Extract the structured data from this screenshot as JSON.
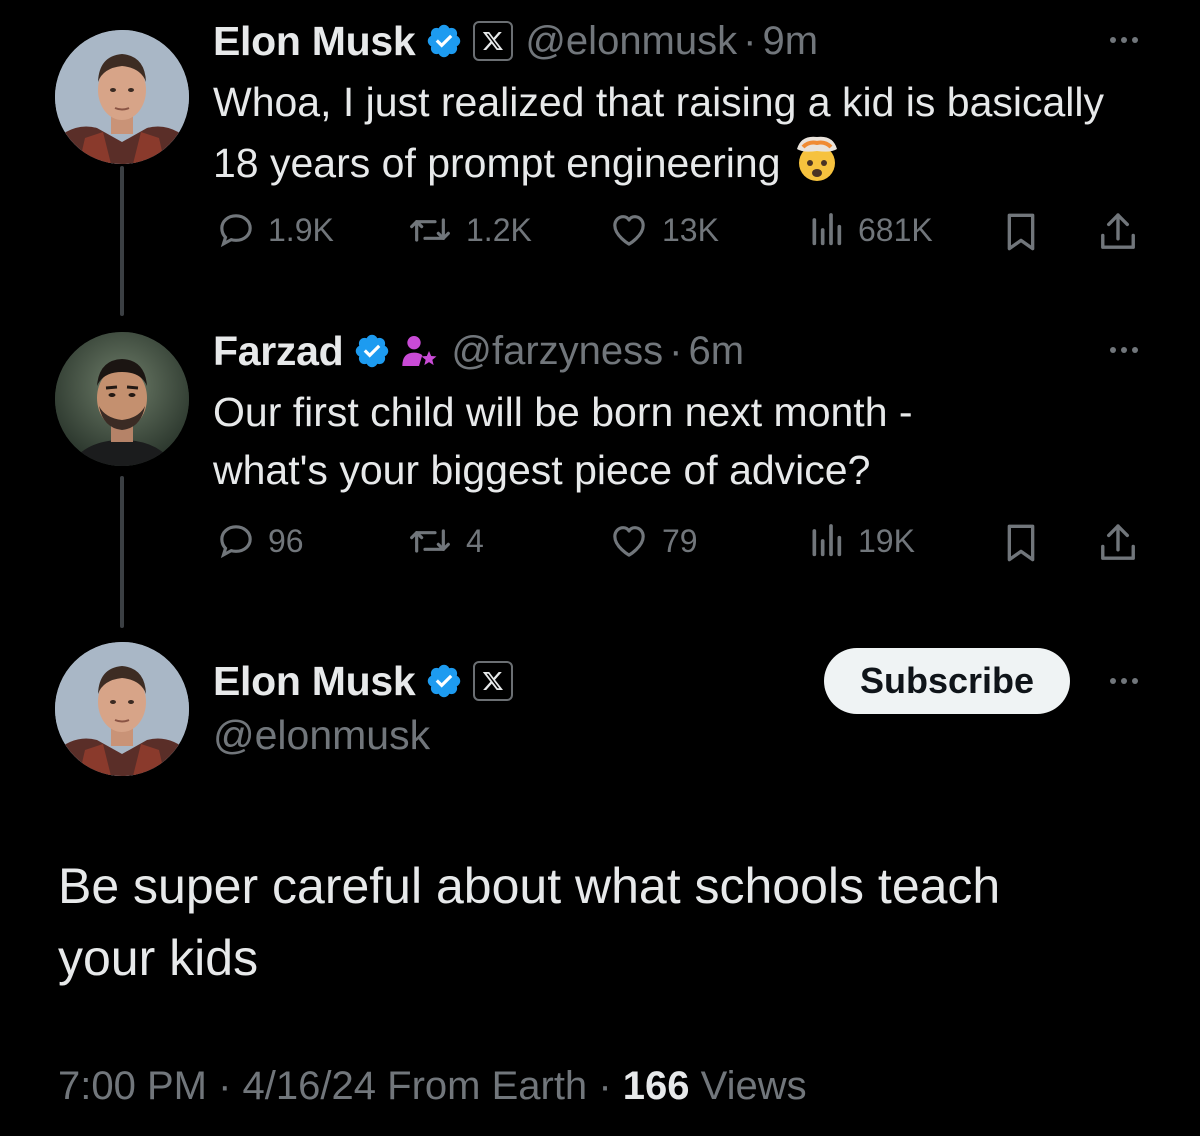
{
  "tweets": [
    {
      "name": "Elon Musk",
      "handle": "@elonmusk",
      "separator": "·",
      "time": "9m",
      "text": "Whoa, I just realized that raising a kid is basically 18 years of prompt engineering",
      "stats": {
        "replies": "1.9K",
        "reposts": "1.2K",
        "likes": "13K",
        "views": "681K"
      }
    },
    {
      "name": "Farzad",
      "handle": "@farzyness",
      "separator": "·",
      "time": "6m",
      "text_lines": [
        "Our first child will be born next month -",
        "what's your biggest piece of advice?"
      ],
      "stats": {
        "replies": "96",
        "reposts": "4",
        "likes": "79",
        "views": "19K"
      }
    }
  ],
  "main_tweet": {
    "name": "Elon Musk",
    "handle": "@elonmusk",
    "subscribe_label": "Subscribe",
    "text_lines": [
      "Be super careful about what schools teach",
      "your kids"
    ],
    "time": "7:00 PM",
    "separator": "·",
    "date": "4/16/24",
    "source": "From Earth",
    "views_count": "166",
    "views_label": "Views"
  },
  "icons": {
    "verified": "verified-badge-icon",
    "x_affiliation": "x-logo-icon",
    "subscriber_badge": "person-star-icon",
    "reply": "speech-bubble-icon",
    "repost": "repost-arrows-icon",
    "like": "heart-icon",
    "views": "bar-chart-icon",
    "bookmark": "bookmark-icon",
    "share": "share-upload-icon",
    "more": "more-dots-icon",
    "emoji": "exploding-head-emoji"
  },
  "colors": {
    "background": "#000000",
    "primary_text": "#e7e9ea",
    "secondary_text": "#71767b",
    "verified_blue": "#1d9bf0",
    "subscriber_pink": "#c94bd6",
    "button_bg": "#eff3f4"
  }
}
